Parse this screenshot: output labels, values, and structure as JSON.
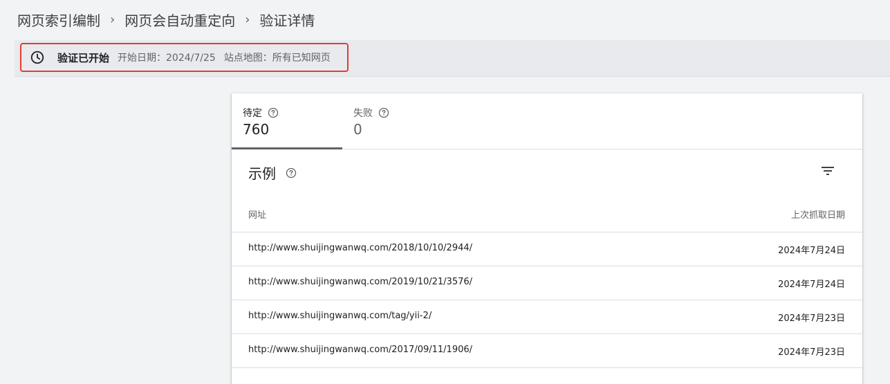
{
  "breadcrumb": {
    "items": [
      "网页索引编制",
      "网页会自动重定向",
      "验证详情"
    ],
    "separator": "›"
  },
  "status": {
    "icon": "clock-icon",
    "title": "验证已开始",
    "start_date": "开始日期：2024/7/25",
    "sitemap": "站点地图：所有已知网页"
  },
  "tabs": [
    {
      "label": "待定",
      "count": "760",
      "active": true
    },
    {
      "label": "失败",
      "count": "0",
      "active": false
    }
  ],
  "examples": {
    "title": "示例",
    "columns": {
      "url": "网址",
      "date": "上次抓取日期"
    },
    "rows": [
      {
        "url": "http://www.shuijingwanwq.com/2018/10/10/2944/",
        "date": "2024年7月24日"
      },
      {
        "url": "http://www.shuijingwanwq.com/2019/10/21/3576/",
        "date": "2024年7月24日"
      },
      {
        "url": "http://www.shuijingwanwq.com/tag/yii-2/",
        "date": "2024年7月23日"
      },
      {
        "url": "http://www.shuijingwanwq.com/2017/09/11/1906/",
        "date": "2024年7月23日"
      }
    ]
  },
  "colors": {
    "background": "#f1f3f4",
    "highlight_border": "#e53935",
    "active_tab_indicator": "#5f6368"
  }
}
